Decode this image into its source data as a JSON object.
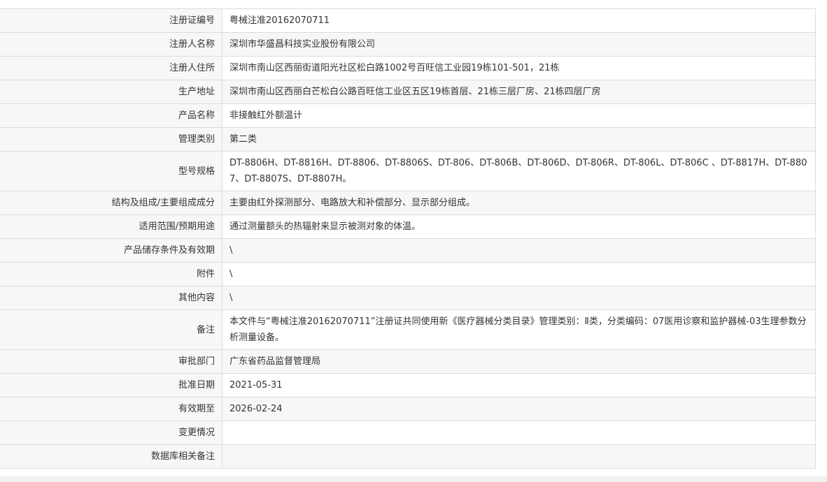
{
  "rows": [
    {
      "label": "注册证编号",
      "value": "粤械注准20162070711"
    },
    {
      "label": "注册人名称",
      "value": "深圳市华盛昌科技实业股份有限公司"
    },
    {
      "label": "注册人住所",
      "value": "深圳市南山区西丽街道阳光社区松白路1002号百旺信工业园19栋101-501，21栋"
    },
    {
      "label": "生产地址",
      "value": "深圳市南山区西丽白芒松白公路百旺信工业区五区19栋首层、21栋三层厂房、21栋四层厂房"
    },
    {
      "label": "产品名称",
      "value": "非接触红外额温计"
    },
    {
      "label": "管理类别",
      "value": "第二类"
    },
    {
      "label": "型号规格",
      "value": "DT-8806H、DT-8816H、DT-8806、DT-8806S、DT-806、DT-806B、DT-806D、DT-806R、DT-806L、DT-806C 、DT-8817H、DT-8807、DT-8807S、DT-8807H。"
    },
    {
      "label": "结构及组成/主要组成成分",
      "value": "主要由红外探测部分、电路放大和补偿部分、显示部分组成。"
    },
    {
      "label": "适用范围/预期用途",
      "value": "通过测量额头的热辐射来显示被测对象的体温。"
    },
    {
      "label": "产品储存条件及有效期",
      "value": "\\"
    },
    {
      "label": "附件",
      "value": "\\"
    },
    {
      "label": "其他内容",
      "value": "\\"
    },
    {
      "label": "备注",
      "value": "本文件与“粤械注准20162070711”注册证共同使用新《医疗器械分类目录》管理类别：Ⅱ类，分类编码：07医用诊察和监护器械-03生理参数分析测量设备。"
    },
    {
      "label": "审批部门",
      "value": "广东省药品监督管理局"
    },
    {
      "label": "批准日期",
      "value": "2021-05-31"
    },
    {
      "label": "有效期至",
      "value": "2026-02-24"
    },
    {
      "label": "变更情况",
      "value": ""
    },
    {
      "label": "数据库相关备注",
      "value": ""
    }
  ]
}
